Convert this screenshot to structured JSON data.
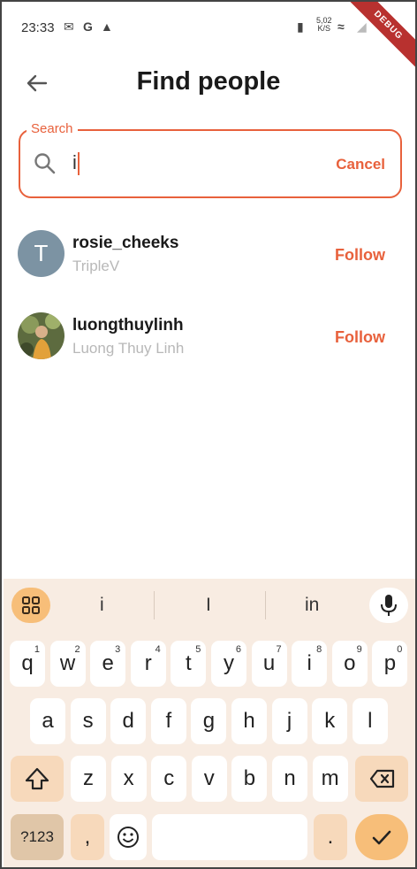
{
  "status": {
    "time": "23:33",
    "speed_value": "5,02",
    "speed_unit": "K/S",
    "debug": "DEBUG"
  },
  "header": {
    "title": "Find people"
  },
  "search": {
    "label": "Search",
    "value": "i",
    "cancel": "Cancel"
  },
  "results": [
    {
      "username": "rosie_cheeks",
      "fullname": "TripleV",
      "avatar_letter": "T",
      "action": "Follow"
    },
    {
      "username": "luongthuylinh",
      "fullname": "Luong Thuy Linh",
      "action": "Follow"
    }
  ],
  "keyboard": {
    "suggestions": [
      "i",
      "I",
      "in"
    ],
    "row1": [
      {
        "k": "q",
        "n": "1"
      },
      {
        "k": "w",
        "n": "2"
      },
      {
        "k": "e",
        "n": "3"
      },
      {
        "k": "r",
        "n": "4"
      },
      {
        "k": "t",
        "n": "5"
      },
      {
        "k": "y",
        "n": "6"
      },
      {
        "k": "u",
        "n": "7"
      },
      {
        "k": "i",
        "n": "8"
      },
      {
        "k": "o",
        "n": "9"
      },
      {
        "k": "p",
        "n": "0"
      }
    ],
    "row2": [
      "a",
      "s",
      "d",
      "f",
      "g",
      "h",
      "j",
      "k",
      "l"
    ],
    "row3": [
      "z",
      "x",
      "c",
      "v",
      "b",
      "n",
      "m"
    ],
    "symbols_key": "?123",
    "comma": ",",
    "period": ".",
    "shift_icon": "shift-icon",
    "backspace_icon": "backspace-icon",
    "enter_icon": "check-icon",
    "emoji_icon": "emoji-icon"
  },
  "colors": {
    "accent": "#e8613c",
    "keyboard_bg": "#f8ece2",
    "key_mod": "#f7d9bb",
    "key_accent": "#f7be79"
  }
}
